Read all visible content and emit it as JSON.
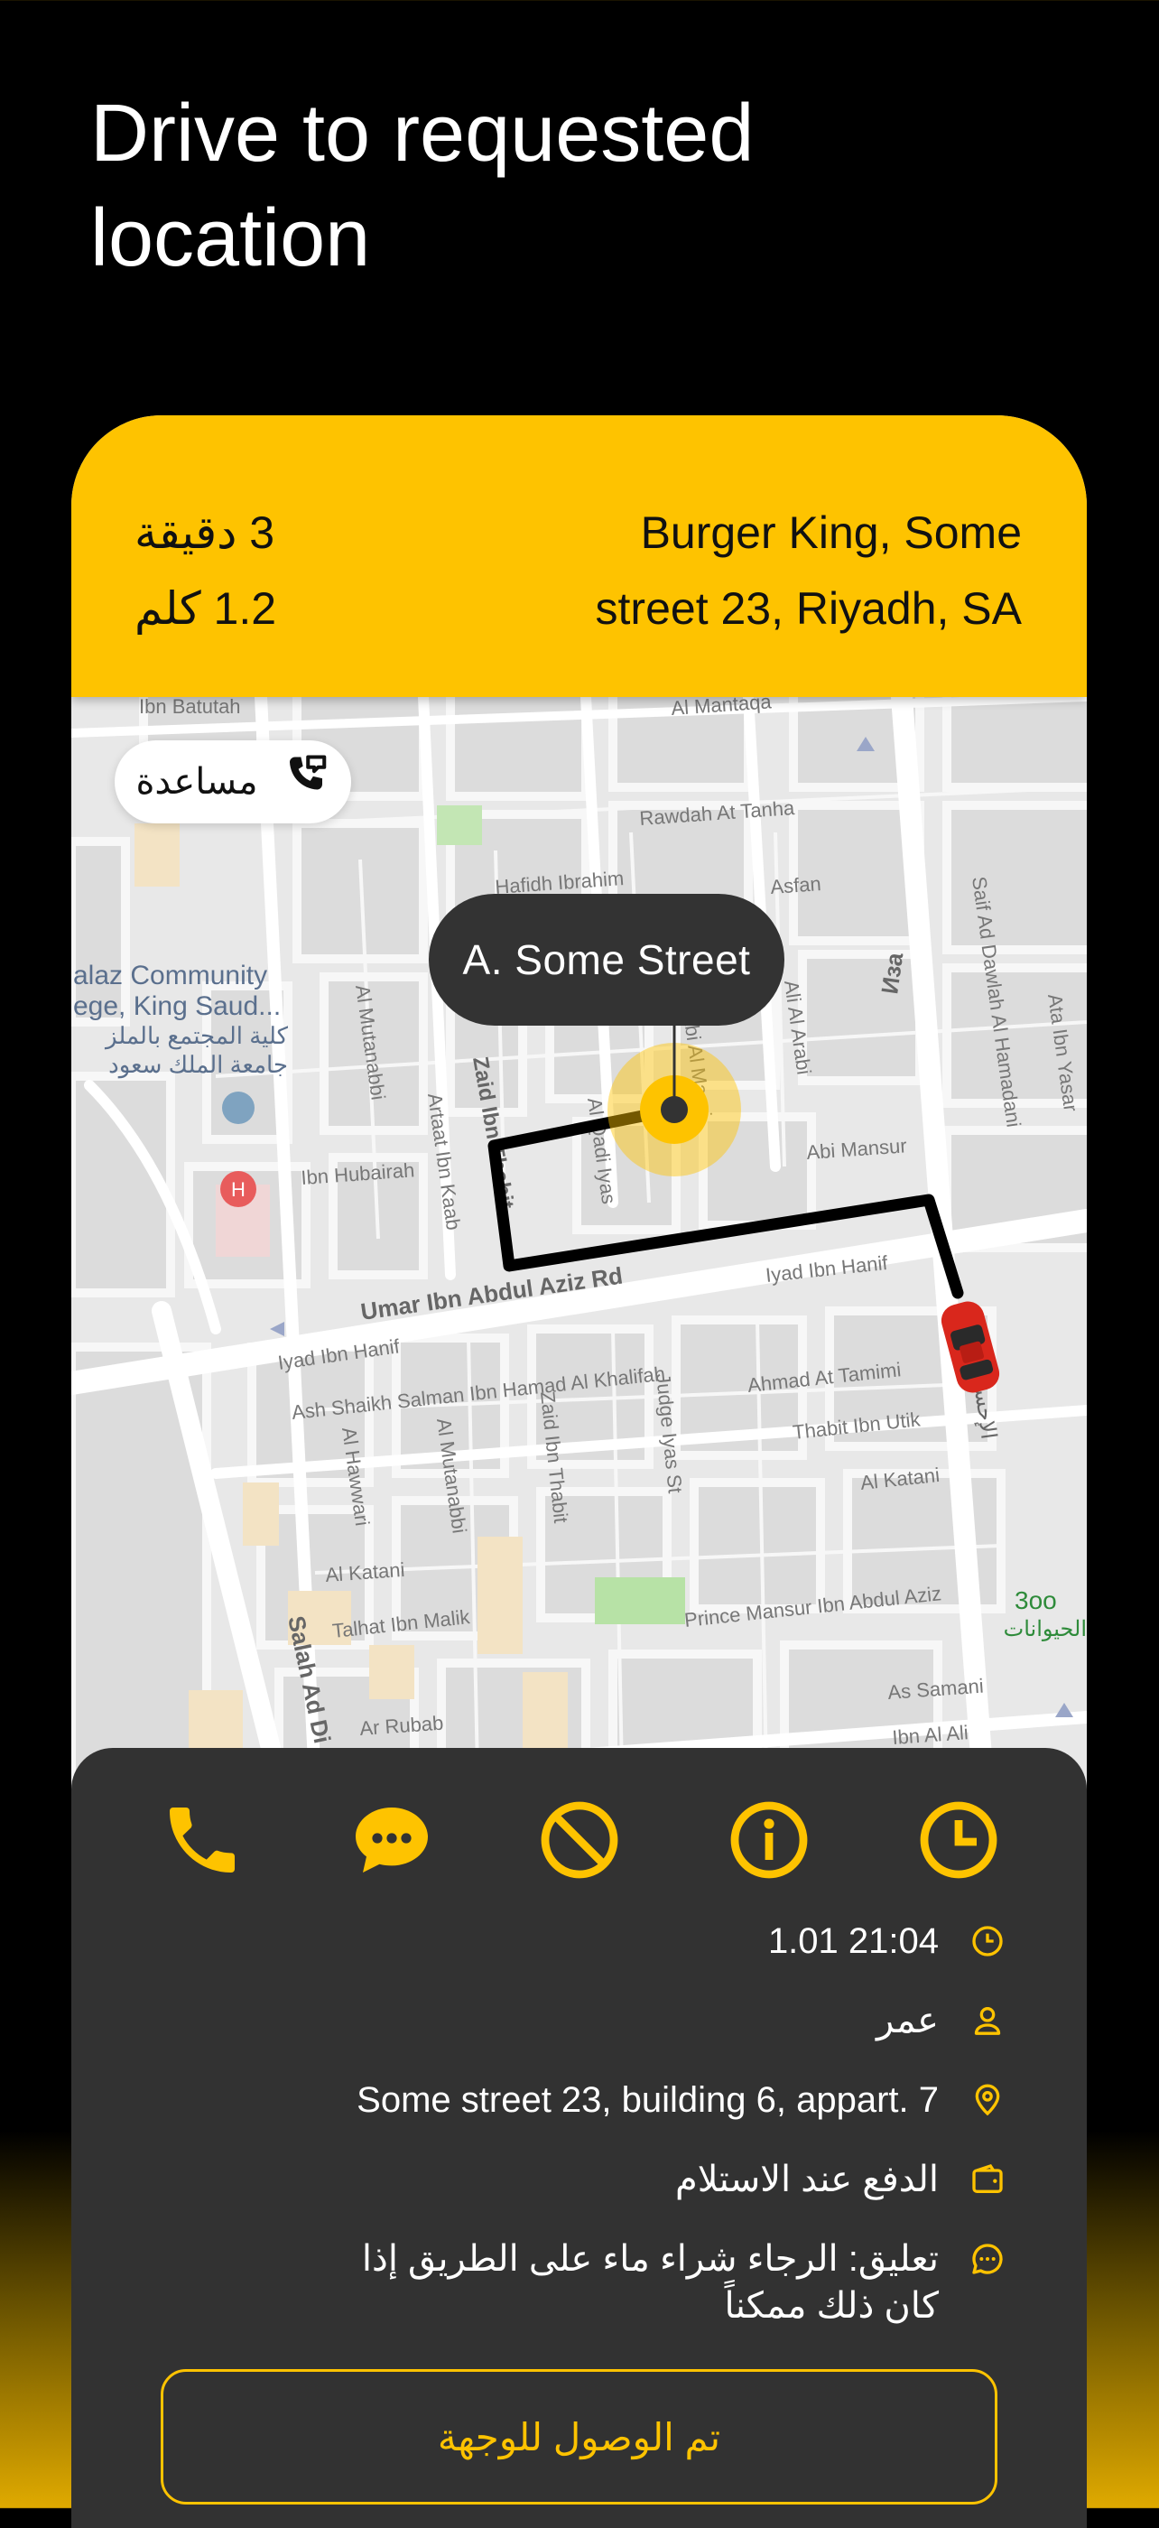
{
  "headline": {
    "line1": "Drive to requested",
    "line2": "location"
  },
  "trip": {
    "eta_minutes": "3 دقيقة",
    "eta_distance": "1.2 كلم",
    "destination_line1": "Burger King, Some",
    "destination_line2": "street 23,  Riyadh, SA"
  },
  "map": {
    "help_label": "مساعدة",
    "pin_label": "A.  Some Street",
    "street_labels": {
      "ibn_batutah": "Ibn Batutah",
      "al_mantaqa": "Al Mantaqa",
      "rawdah": "Rawdah At Tanha",
      "ibrahim": "Hafidh Ibrahim",
      "asfan": "Asfan",
      "ibn_hubairah": "Ibn Hubairah",
      "abi_mansur": "Abi Mansur",
      "umar": "Umar Ibn Abdul Aziz Rd",
      "iyad1": "Iyad Ibn Hanif",
      "iyad2": "Iyad Ibn Hanif",
      "ash_shaikh": "Ash Shaikh Salman Ibn Hamad Al Khalifah",
      "ahmad": "Ahmad At Tamimi",
      "thabit": "Thabit Ibn Utik",
      "katani1": "Al Katani",
      "katani2": "Al Katani",
      "prince": "Prince Mansur Ibn Abdul Aziz",
      "talhat": "Talhat Ibn Malik",
      "samani": "As Samani",
      "rubab": "Ar Rubab",
      "mutanabbi1": "Al Mutanabbi",
      "mutanabbi2": "Al Mutanabbi",
      "zaid": "Zaid Ibn Thabit",
      "zaid2": "Zaid Ibn Thabit",
      "judge": "Judge Iyas St",
      "hawwari": "Al Hawwari",
      "salah": "Salah Ad Di",
      "saif": "Saif Ad Dawlah Al Hamadani",
      "ata": "Ata Ibn Yasar",
      "artaat": "Artaat Ibn Kaab",
      "iyas": "Al Qadi Iyas",
      "maarri": "Abi Al Maari",
      "arabi": "Ali Al Arabi",
      "ibn_al_ali": "Ibn Al Ali",
      "college1": "alaz Community",
      "college2": "ege, King Saud...",
      "college3": "كلية المجتمع بالملز",
      "college4": "جامعة الملك سعود",
      "zoo1": "3oo",
      "zoo2": "الحيوانات",
      "road_ar": "الإحسـ",
      "road_ar2": "Иза"
    }
  },
  "details": {
    "datetime": "1.01  21:04",
    "customer": "عمر",
    "address": "Some street 23, building 6, appart. 7",
    "payment": "الدفع عند الاستلام",
    "comment_line1": "تعليق: الرجاء شراء ماء على الطريق إذا",
    "comment_line2": "كان ذلك ممكناً",
    "arrive_button": "تم الوصول للوجهة"
  },
  "colors": {
    "accent": "#fec300",
    "sheet": "#323232",
    "route": "#000000",
    "car": "#d9271c"
  },
  "icons": [
    "phone-icon",
    "chat-icon",
    "cancel-icon",
    "info-icon",
    "clock-icon",
    "time-icon",
    "user-icon",
    "location-pin-icon",
    "wallet-icon",
    "comment-icon",
    "phone-help-icon"
  ]
}
